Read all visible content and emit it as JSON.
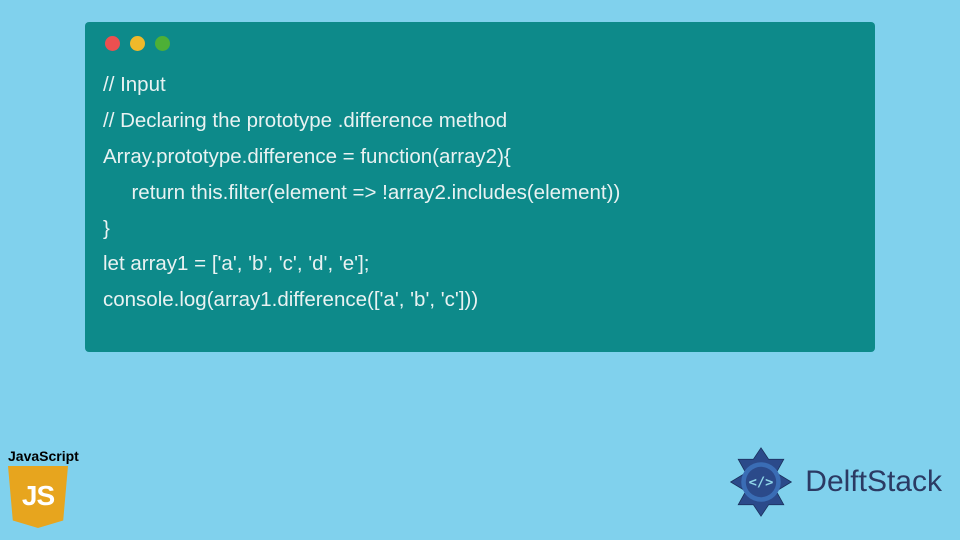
{
  "window": {
    "dotColors": [
      "#ec5050",
      "#efb92a",
      "#4db037"
    ]
  },
  "code": {
    "lines": [
      "// Input",
      "// Declaring the prototype .difference method",
      "Array.prototype.difference = function(array2){",
      "     return this.filter(element => !array2.includes(element))",
      "}",
      "let array1 = ['a', 'b', 'c', 'd', 'e'];",
      "console.log(array1.difference(['a', 'b', 'c']))"
    ]
  },
  "jsBadge": {
    "label": "JavaScript",
    "logoText": "JS"
  },
  "brand": {
    "name": "DelftStack"
  },
  "colors": {
    "pageBg": "#80d1ed",
    "windowBg": "#0d8a8a",
    "codeText": "#e9f2f2",
    "jsLogo": "#e7a51e",
    "brandText": "#2b3a63"
  }
}
